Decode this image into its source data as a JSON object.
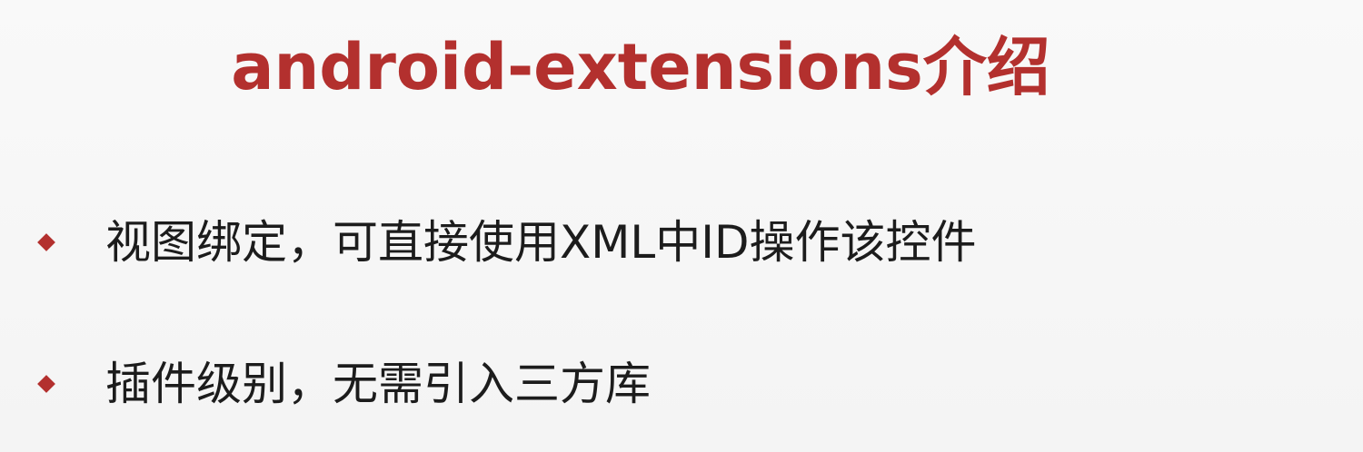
{
  "title": "android-extensions介绍",
  "bullets": [
    {
      "icon": "diamond-bullet-icon",
      "text": "视图绑定，可直接使用XML中ID操作该控件"
    },
    {
      "icon": "diamond-bullet-icon",
      "text": "插件级别，无需引入三方库"
    }
  ],
  "colors": {
    "accent": "#b3302e",
    "text": "#1c1c1c",
    "background": "#f7f7f7"
  }
}
